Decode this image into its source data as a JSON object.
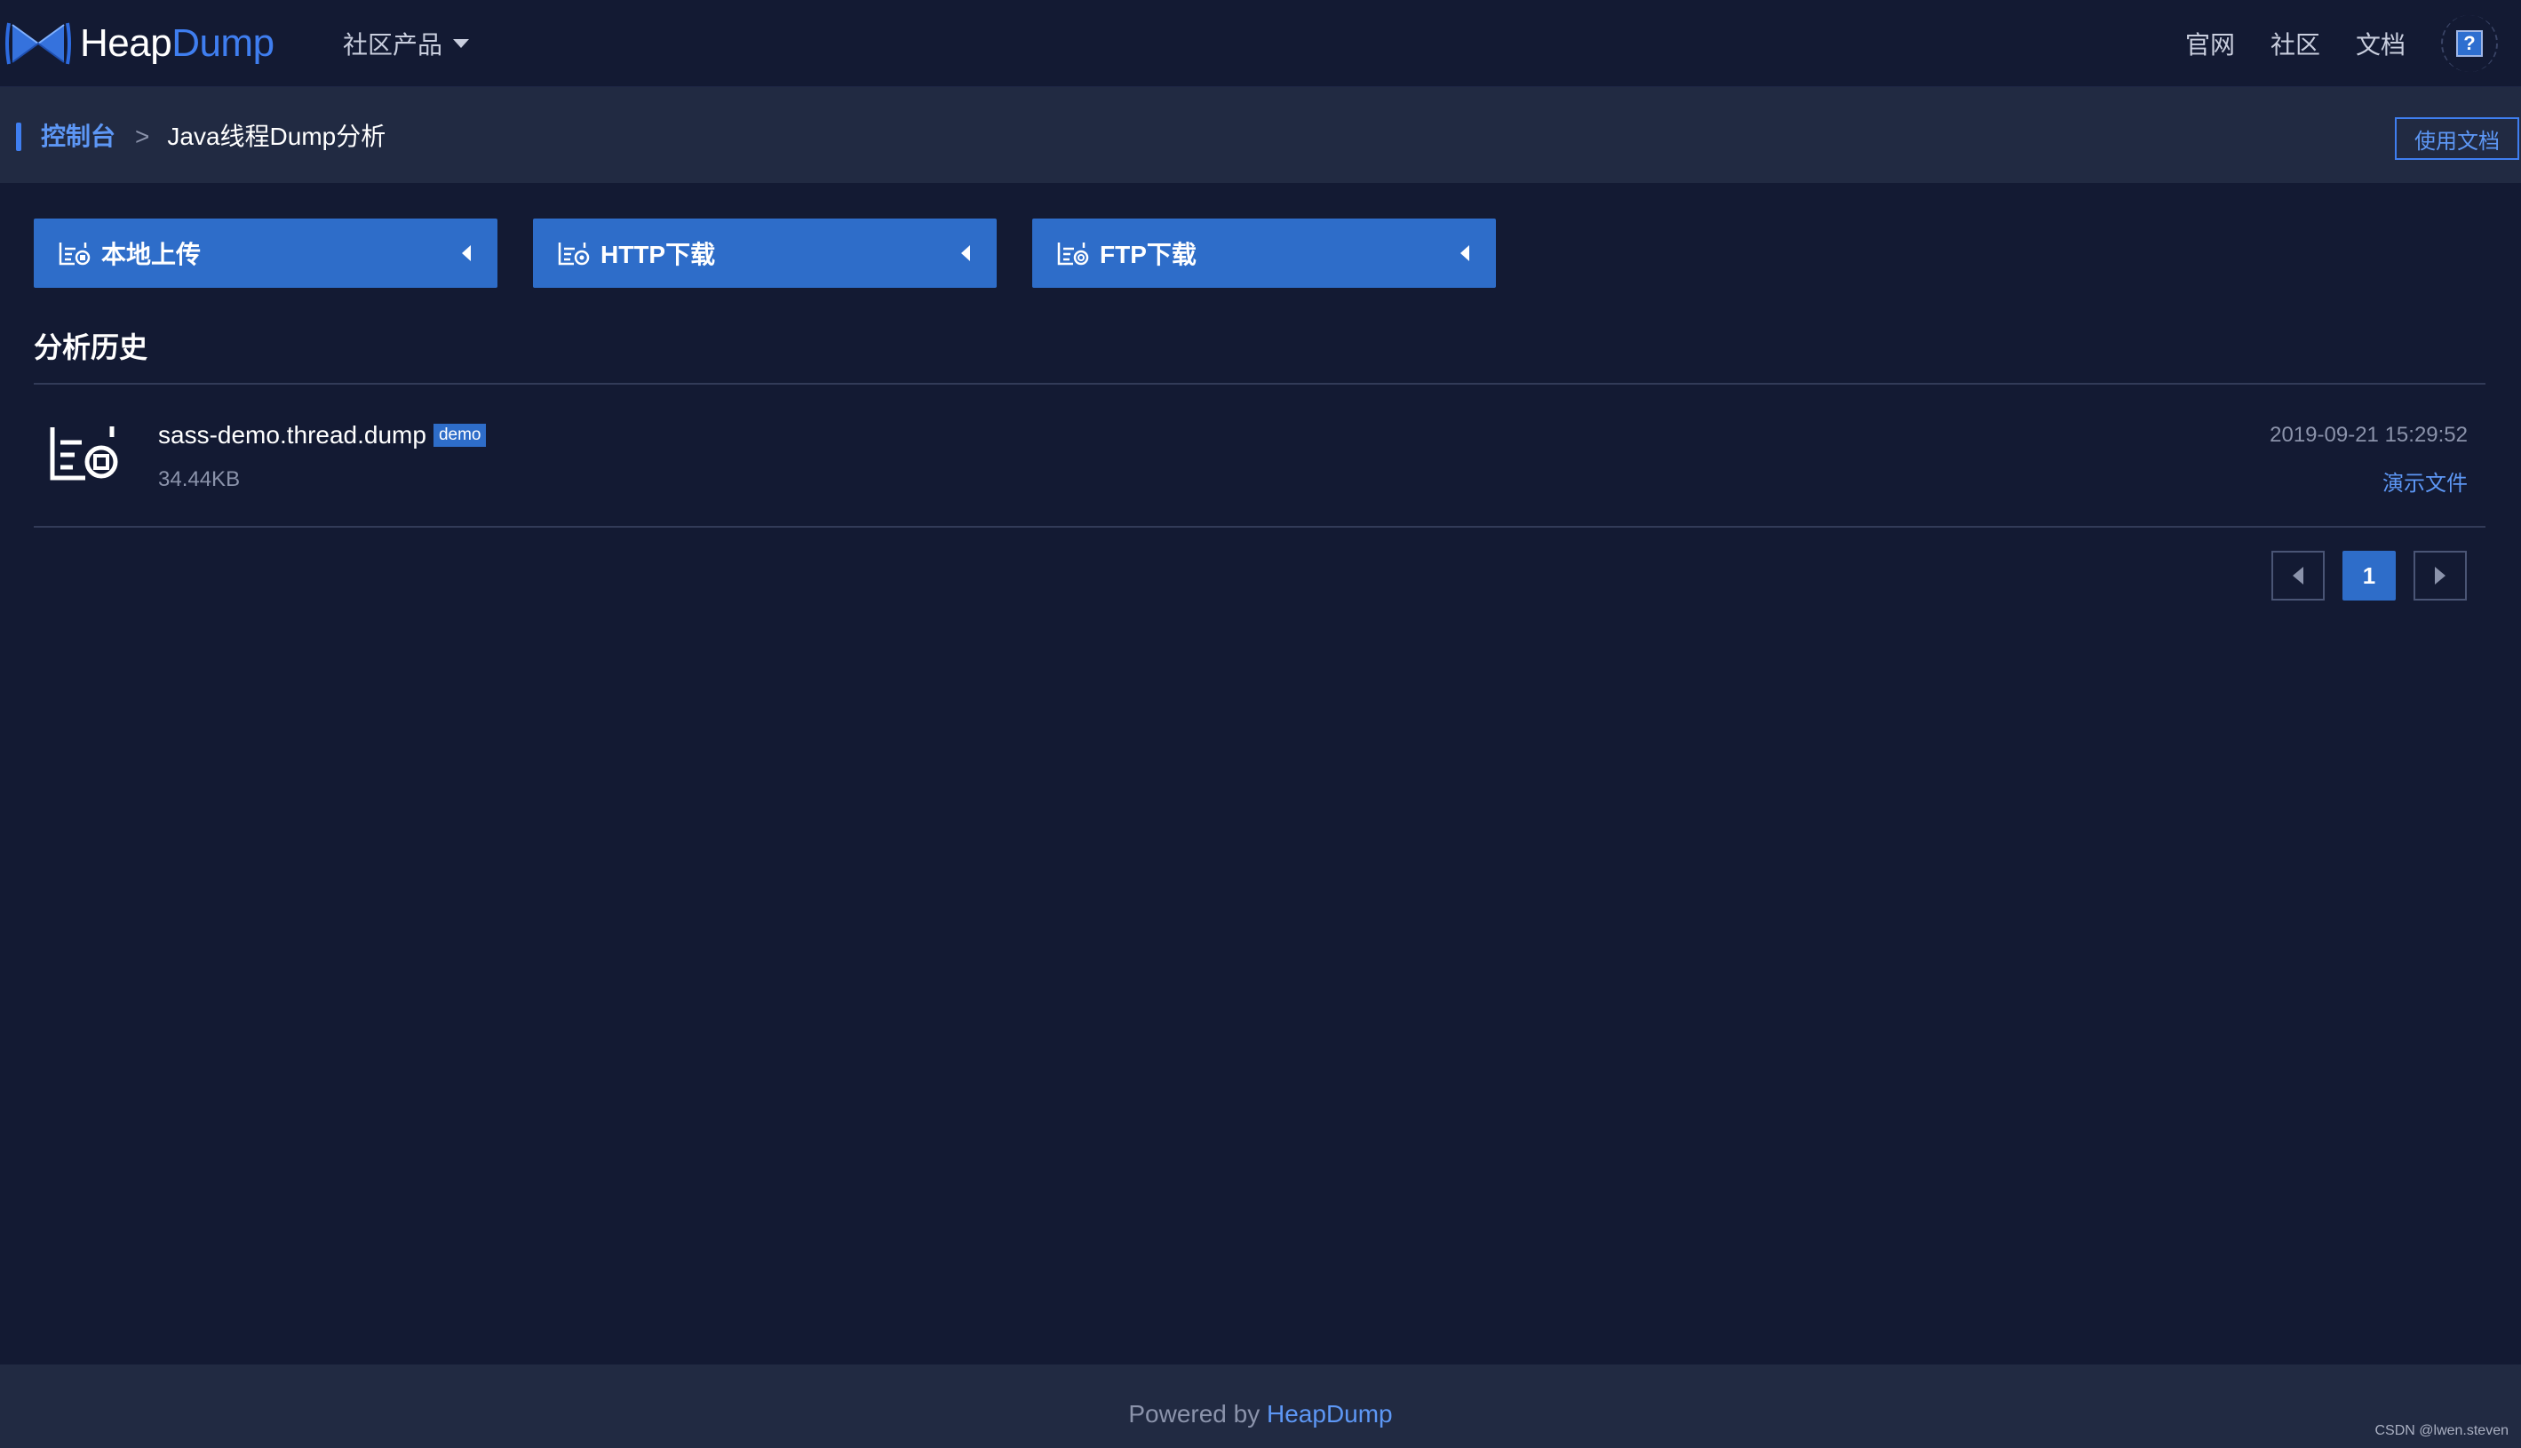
{
  "header": {
    "logo_text_white": "Heap",
    "logo_text_blue": "Dump",
    "products_label": "社区产品",
    "nav_links": [
      "官网",
      "社区",
      "文档"
    ],
    "help_label": "?"
  },
  "breadcrumb": {
    "root": "控制台",
    "separator": ">",
    "current": "Java线程Dump分析",
    "doc_button": "使用文档"
  },
  "actions": [
    {
      "label": "本地上传",
      "icon": "file-upload-icon"
    },
    {
      "label": "HTTP下载",
      "icon": "file-http-icon"
    },
    {
      "label": "FTP下载",
      "icon": "file-ftp-icon"
    }
  ],
  "history": {
    "title": "分析历史",
    "items": [
      {
        "name": "sass-demo.thread.dump",
        "tag": "demo",
        "size": "34.44KB",
        "date": "2019-09-21 15:29:52",
        "link": "演示文件"
      }
    ]
  },
  "pagination": {
    "current_page": "1"
  },
  "footer": {
    "powered_prefix": "Powered by ",
    "powered_brand": "HeapDump",
    "watermark": "CSDN @lwen.steven"
  },
  "colors": {
    "background": "#131a33",
    "bar": "#212a42",
    "accent": "#2e6dc9",
    "link": "#5d97f5"
  }
}
